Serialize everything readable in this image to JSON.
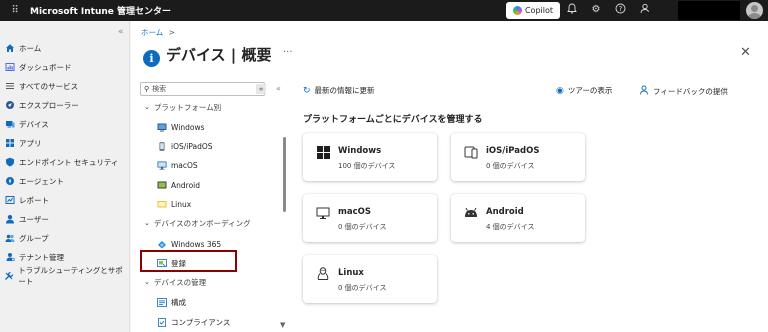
{
  "topbar": {
    "app_title": "Microsoft Intune 管理センター",
    "copilot_label": "Copilot"
  },
  "leftnav": {
    "items": [
      {
        "label": "ホーム",
        "icon": "home-icon",
        "color": "#0f6cbd"
      },
      {
        "label": "ダッシュボード",
        "icon": "dashboard-icon",
        "color": "#4f6bed"
      },
      {
        "label": "すべてのサービス",
        "icon": "list-icon",
        "color": "#5c5c5c"
      },
      {
        "label": "エクスプローラー",
        "icon": "explorer-icon",
        "color": "#0f6cbd"
      },
      {
        "label": "デバイス",
        "icon": "devices-icon",
        "color": "#0f6cbd"
      },
      {
        "label": "アプリ",
        "icon": "apps-icon",
        "color": "#0f6cbd"
      },
      {
        "label": "エンドポイント セキュリティ",
        "icon": "shield-icon",
        "color": "#0f6cbd"
      },
      {
        "label": "エージェント",
        "icon": "agent-icon",
        "color": "#0f6cbd"
      },
      {
        "label": "レポート",
        "icon": "reports-icon",
        "color": "#0f6cbd"
      },
      {
        "label": "ユーザー",
        "icon": "user-icon",
        "color": "#0f6cbd"
      },
      {
        "label": "グループ",
        "icon": "group-icon",
        "color": "#0f6cbd"
      },
      {
        "label": "テナント管理",
        "icon": "tenant-icon",
        "color": "#0f6cbd"
      },
      {
        "label": "トラブルシューティングとサポート",
        "icon": "tools-icon",
        "color": "#0f6cbd"
      }
    ]
  },
  "breadcrumb": {
    "home": "ホーム",
    "separator": ">"
  },
  "page": {
    "title": "デバイス | 概要"
  },
  "search": {
    "placeholder": "検索"
  },
  "tree": {
    "group_platform": "プラットフォーム別",
    "platform_items": [
      "Windows",
      "iOS/iPadOS",
      "macOS",
      "Android",
      "Linux"
    ],
    "group_onboarding": "デバイスのオンボーディング",
    "onboarding_items": [
      "Windows 365",
      "登録"
    ],
    "group_manage": "デバイスの管理",
    "manage_items": [
      "構成",
      "コンプライアンス"
    ]
  },
  "toolbar": {
    "refresh": "最新の情報に更新",
    "tour": "ツアーの表示",
    "feedback": "フィードバックの提供"
  },
  "section": {
    "title": "プラットフォームごとにデバイスを管理する"
  },
  "cards": [
    {
      "title": "Windows",
      "subtitle": "100 個のデバイス",
      "icon": "windows-icon"
    },
    {
      "title": "iOS/iPadOS",
      "subtitle": "0 個のデバイス",
      "icon": "mobile-devices-icon"
    },
    {
      "title": "macOS",
      "subtitle": "0 個のデバイス",
      "icon": "monitor-icon"
    },
    {
      "title": "Android",
      "subtitle": "4 個のデバイス",
      "icon": "android-icon"
    },
    {
      "title": "Linux",
      "subtitle": "0 個のデバイス",
      "icon": "linux-icon"
    }
  ],
  "colors": {
    "accent": "#0f6cbd",
    "topbar": "#1b1b1b",
    "highlight_border": "#8b0000"
  }
}
